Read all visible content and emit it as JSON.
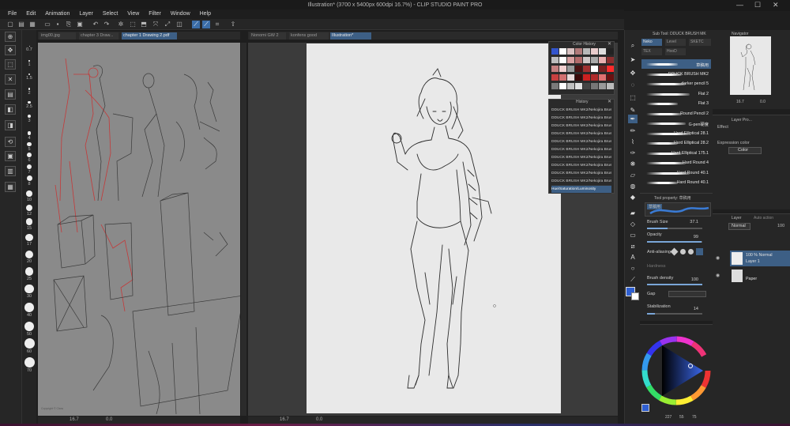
{
  "app": {
    "title": "Illustration* (3700 x 5400px 600dpi 16.7%) - CLIP STUDIO PAINT PRO"
  },
  "menu": [
    "File",
    "Edit",
    "Animation",
    "Layer",
    "Select",
    "View",
    "Filter",
    "Window",
    "Help"
  ],
  "window_controls": {
    "minimize": "—",
    "maximize": "☐",
    "close": "✕"
  },
  "canvas_tabs_left": [
    "img00.jpg",
    "chapter 3 Draw...",
    "chapter 1 Drawing 2.pdf"
  ],
  "canvas_tabs_main": [
    "Nonomi GW 2",
    "konfens good",
    "Illustration*"
  ],
  "brush_sizes": [
    "0.7",
    "1",
    "1.5",
    "2",
    "2.5",
    "3",
    "4",
    "5",
    "6",
    "7",
    "8",
    "10",
    "12",
    "15",
    "17",
    "20",
    "25",
    "30",
    "40",
    "50",
    "60",
    "70"
  ],
  "status_left": {
    "zoom": "16.7",
    "angle": "0.0"
  },
  "status_main": {
    "zoom": "16.7",
    "angle": "0.0"
  },
  "color_history": {
    "title": "Color History",
    "swatches": [
      "#3355cc",
      "#ffffff",
      "#d9c2c2",
      "#b07a7a",
      "#b8b8b8",
      "#e8cccc",
      "#ddd",
      "#222",
      "#bdbdbd",
      "#ffffff",
      "#d9a0a0",
      "#b36a6a",
      "#d0c8c8",
      "#aaa",
      "#e8b0b0",
      "#8c2e2e",
      "#c48080",
      "#f2d0d0",
      "#9a9a9a",
      "#4a1010",
      "#a03030",
      "#ffffff",
      "#7a2020",
      "#ff2a2a",
      "#c84040",
      "#d27070",
      "#e8d8d8",
      "#3a0808",
      "#cc2020",
      "#b02a2a",
      "#e07070",
      "#6a1010",
      "#7a7a7a",
      "#ffffff",
      "#c0c0c0",
      "#e0e0e0",
      "#444",
      "#777",
      "#999",
      "#bbb"
    ]
  },
  "history": {
    "title": "History",
    "items": [
      "DDUCK BRUSH MK2/Nekojira Brush Se...",
      "DDUCK BRUSH MK2/Nekojira Brush Se...",
      "DDUCK BRUSH MK2/Nekojira Brush Se...",
      "DDUCK BRUSH MK2/Nekojira Brush Se...",
      "DDUCK BRUSH MK2/Nekojira Brush Se...",
      "DDUCK BRUSH MK2/Nekojira Brush Se...",
      "DDUCK BRUSH MK2/Nekojira Brush Se...",
      "DDUCK BRUSH MK2/Nekojira Brush Se...",
      "DDUCK BRUSH MK2/Nekojira Brush Se...",
      "DDUCK BRUSH MK2/Nekojira Brush Se...",
      "Hue/Saturation/Luminosity"
    ]
  },
  "subtool": {
    "title": "Sub Tool: DDUCK BRUSH MK",
    "groups": [
      "Neko",
      "Level",
      "SKETC",
      "TEX",
      "HooD"
    ],
    "brushes": [
      "草稿用",
      "DDUCK BRUSH MK2",
      "darker pencil 5",
      "Flat 2",
      "Flat 3",
      "Round Pencil 2",
      "G-pen硬度",
      "Hard Elliptical 28.1",
      "Hard Elliptical 28.2",
      "Hard Elliptical 175.1",
      "Hard Round 4",
      "Hard Round 40.1",
      "Hard Round 40.1"
    ]
  },
  "tool_property": {
    "title": "Tool property: 草稿用",
    "preview_label": "草稿用",
    "brush_size": {
      "label": "Brush Size",
      "value": "37.1",
      "fill": 0.37
    },
    "opacity": {
      "label": "Opacity",
      "value": "99",
      "fill": 0.99
    },
    "anti_aliasing": {
      "label": "Anti-aliasing"
    },
    "hardness": {
      "label": "Hardness"
    },
    "brush_density": {
      "label": "Brush density",
      "value": "100",
      "fill": 1.0
    },
    "gap": {
      "label": "Gap"
    },
    "stabilization": {
      "label": "Stabilization",
      "value": "14",
      "fill": 0.14
    }
  },
  "color_wheel": {
    "values": [
      "227",
      "55",
      "75"
    ],
    "main_color": "#2f5fd1",
    "sub_color": "#ffffff"
  },
  "navigator": {
    "title": "Navigator",
    "zoom": "16.7",
    "angle": "0.0"
  },
  "layer_property": {
    "title": "Layer Pro...",
    "effect_label": "Effect",
    "expression_color_label": "Expression color",
    "expression_color_value": "Color"
  },
  "layer_panel": {
    "title": "Layer",
    "tab2": "Auto action",
    "blend_mode": "Normal",
    "opacity": "100",
    "layers": [
      {
        "line1": "100 % Normal",
        "line2": "Layer 1",
        "active": true
      },
      {
        "line1": "",
        "line2": "Paper",
        "active": false
      }
    ]
  },
  "colors": {
    "accent": "#3d5f85",
    "main_color": "#2f5fd1"
  }
}
